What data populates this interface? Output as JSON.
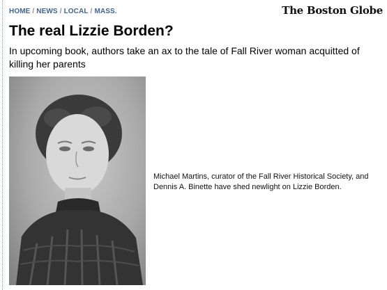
{
  "breadcrumb": {
    "items": [
      "HOME",
      "NEWS",
      "LOCAL",
      "MASS."
    ],
    "separator": "/"
  },
  "masthead": "The Boston Globe",
  "article": {
    "headline": "The real Lizzie Borden?",
    "subhead": "In upcoming book, authors take an ax to the tale of Fall River woman acquitted of killing her parents",
    "caption": "Michael Martins, curator of the Fall River Historical Society, and Dennis A. Binette have shed newlight on Lizzie Borden."
  },
  "colors": {
    "breadcrumb_link": "#3f6397",
    "text": "#000000",
    "background": "#ffffff"
  }
}
